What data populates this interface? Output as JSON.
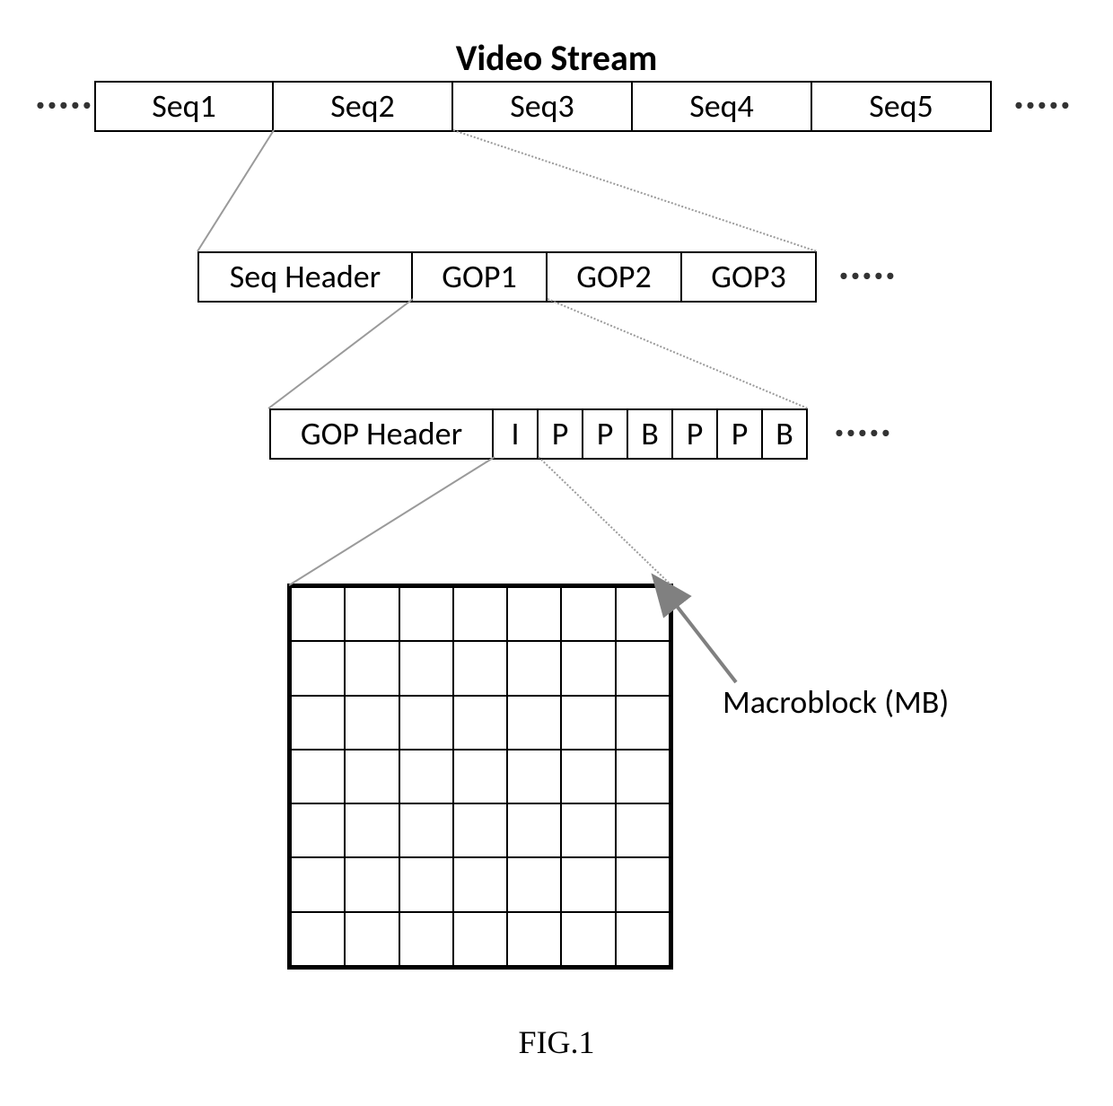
{
  "title": "Video Stream",
  "sequences": [
    "Seq1",
    "Seq2",
    "Seq3",
    "Seq4",
    "Seq5"
  ],
  "seq_expansion": {
    "header": "Seq Header",
    "gops": [
      "GOP1",
      "GOP2",
      "GOP3"
    ]
  },
  "gop_expansion": {
    "header": "GOP Header",
    "frames": [
      "I",
      "P",
      "P",
      "B",
      "P",
      "P",
      "B"
    ]
  },
  "macroblock": {
    "label": "Macroblock (MB)",
    "rows": 7,
    "cols": 7
  },
  "figure_caption": "FIG.1",
  "ellipsis": "•••••"
}
